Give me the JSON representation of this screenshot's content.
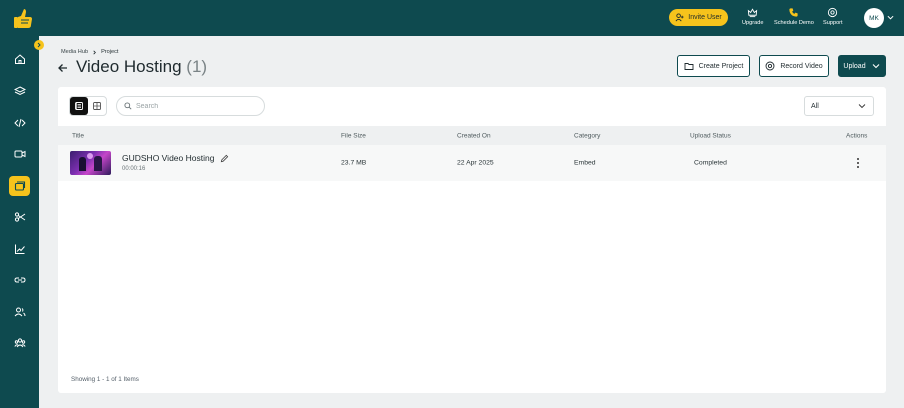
{
  "topbar": {
    "invite_label": "Invite User",
    "nav": [
      {
        "label": "Upgrade",
        "icon": "crown-icon"
      },
      {
        "label": "Schedule Demo",
        "icon": "phone-icon"
      },
      {
        "label": "Support",
        "icon": "support-icon"
      }
    ],
    "avatar_initials": "MK"
  },
  "sidebar": {
    "items": [
      {
        "name": "home",
        "icon": "home-icon"
      },
      {
        "name": "layers",
        "icon": "layers-icon"
      },
      {
        "name": "code",
        "icon": "code-icon"
      },
      {
        "name": "video",
        "icon": "video-icon"
      },
      {
        "name": "media-hub",
        "icon": "media-hub-icon",
        "active": true
      },
      {
        "name": "editor",
        "icon": "scissors-icon"
      },
      {
        "name": "analytics",
        "icon": "chart-icon"
      },
      {
        "name": "links",
        "icon": "link-icon"
      },
      {
        "name": "users",
        "icon": "users-icon"
      },
      {
        "name": "teams",
        "icon": "team-icon"
      }
    ]
  },
  "breadcrumb": {
    "root": "Media Hub",
    "current": "Project"
  },
  "page": {
    "title": "Video Hosting",
    "count": "(1)"
  },
  "actions": {
    "create": "Create Project",
    "record": "Record Video",
    "upload": "Upload"
  },
  "toolbar": {
    "search_placeholder": "Search",
    "filter_value": "All"
  },
  "table": {
    "columns": [
      "Title",
      "File Size",
      "Created On",
      "Category",
      "Upload Status",
      "Actions"
    ],
    "rows": [
      {
        "title": "GUDSHO Video Hosting",
        "duration": "00:00:16",
        "size": "23.7 MB",
        "created": "22 Apr 2025",
        "category": "Embed",
        "status": "Completed"
      }
    ]
  },
  "footer": {
    "summary": "Showing 1 - 1 of 1 Items"
  },
  "colors": {
    "primary": "#0e4a4f",
    "accent": "#f6c31c"
  }
}
